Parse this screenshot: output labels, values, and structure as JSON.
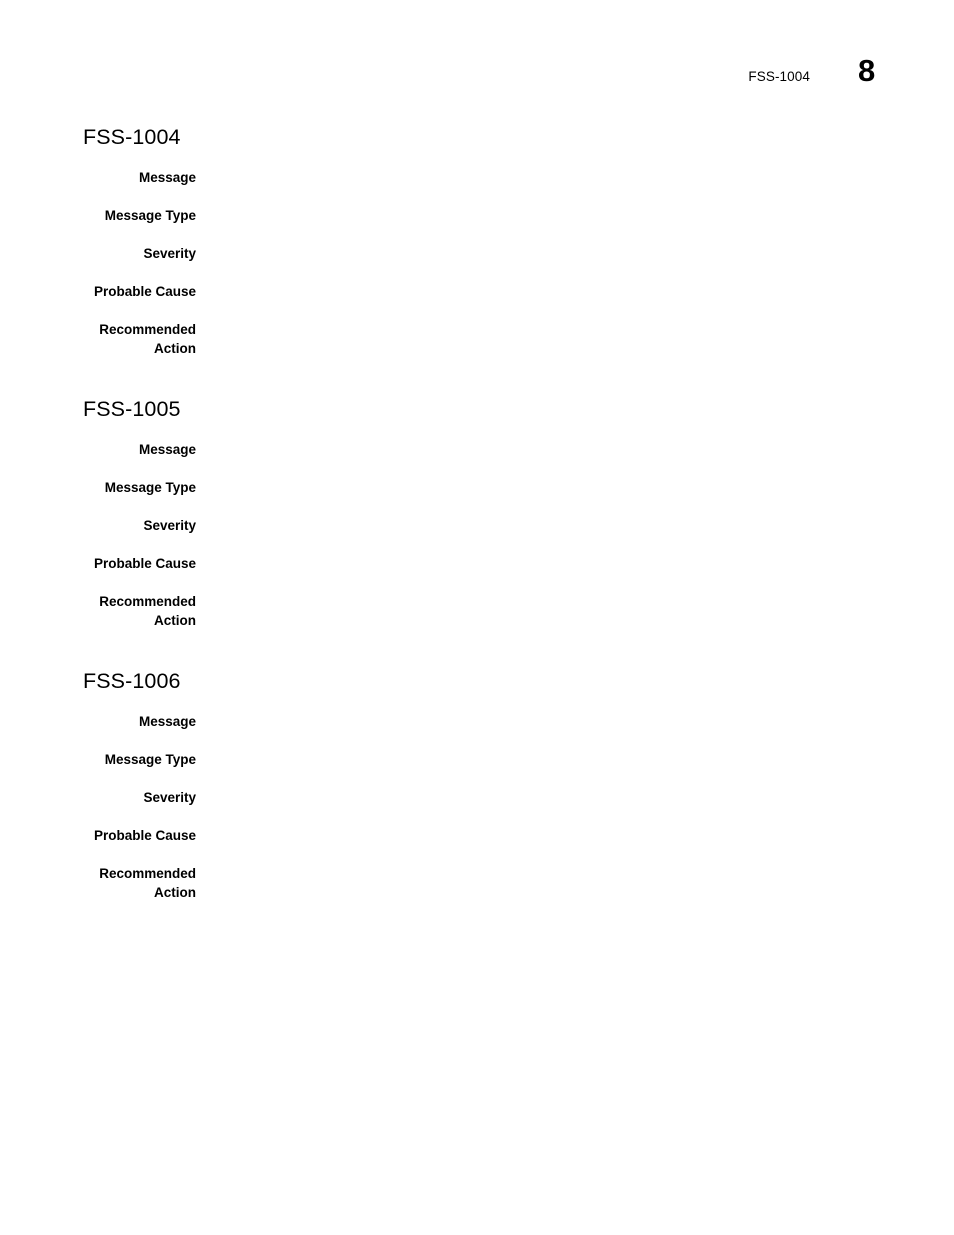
{
  "header": {
    "doc_id": "FSS-1004",
    "page_number": "8"
  },
  "sections": [
    {
      "heading": "FSS-1004",
      "fields": [
        {
          "label": "Message",
          "value": ""
        },
        {
          "label": "Message Type",
          "value": ""
        },
        {
          "label": "Severity",
          "value": ""
        },
        {
          "label": "Probable Cause",
          "value": ""
        },
        {
          "label": "Recommended\nAction",
          "value": ""
        }
      ]
    },
    {
      "heading": "FSS-1005",
      "fields": [
        {
          "label": "Message",
          "value": ""
        },
        {
          "label": "Message Type",
          "value": ""
        },
        {
          "label": "Severity",
          "value": ""
        },
        {
          "label": "Probable Cause",
          "value": ""
        },
        {
          "label": "Recommended\nAction",
          "value": ""
        }
      ]
    },
    {
      "heading": "FSS-1006",
      "fields": [
        {
          "label": "Message",
          "value": ""
        },
        {
          "label": "Message Type",
          "value": ""
        },
        {
          "label": "Severity",
          "value": ""
        },
        {
          "label": "Probable Cause",
          "value": ""
        },
        {
          "label": "Recommended\nAction",
          "value": ""
        }
      ]
    }
  ]
}
